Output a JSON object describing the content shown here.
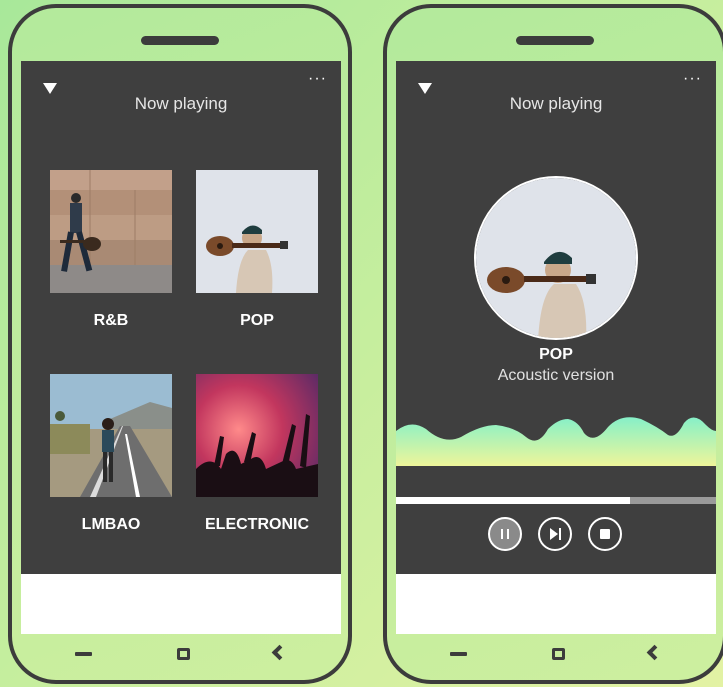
{
  "colors": {
    "screen_bg": "#3f3f3f",
    "frame": "#3c3c3c",
    "wave_top": "#86f0c8",
    "wave_bottom": "#eef59a"
  },
  "left_screen": {
    "title": "Now playing",
    "menu_icon": "triangle-down-icon",
    "more_icon": "more-horizontal-icon",
    "more_glyph": "···",
    "genres": [
      {
        "label": "R&B"
      },
      {
        "label": "POP"
      },
      {
        "label": "LMBAO"
      },
      {
        "label": "ELECTRONIC"
      }
    ]
  },
  "right_screen": {
    "title": "Now playing",
    "menu_icon": "triangle-down-icon",
    "more_icon": "more-horizontal-icon",
    "more_glyph": "···",
    "song": {
      "title": "POP",
      "subtitle": "Acoustic version"
    },
    "progress": 0.73,
    "controls": [
      "pause-icon",
      "skip-next-icon",
      "stop-icon"
    ]
  },
  "navbar": [
    "recent-apps-icon",
    "home-icon",
    "back-icon"
  ]
}
